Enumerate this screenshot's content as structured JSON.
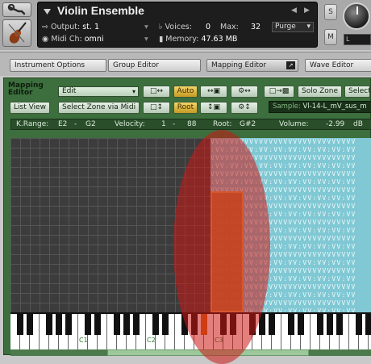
{
  "header": {
    "instrument_name": "Violin Ensemble",
    "output_label": "Output:",
    "output_value": "st. 1",
    "voices_label": "Voices:",
    "voices_value": "0",
    "max_label": "Max:",
    "max_value": "32",
    "purge_label": "Purge",
    "midi_label": "Midi Ch:",
    "midi_value": "omni",
    "memory_label": "Memory:",
    "memory_value": "47.63 MB",
    "solo_button": "S",
    "mute_button": "M",
    "tune_value": "L"
  },
  "editor_tabs": [
    {
      "label": "Instrument Options"
    },
    {
      "label": "Group Editor"
    },
    {
      "label": "Mapping Editor"
    },
    {
      "label": "Wave Editor"
    }
  ],
  "mapping": {
    "title": "Mapping Editor",
    "edit_menu": "Edit",
    "list_view": "List View",
    "select_zone_via_midi": "Select Zone via Midi",
    "auto_label": "Auto",
    "root_label": "Root",
    "solo_zone": "Solo Zone",
    "select_label": "Selecte",
    "sample_label": "Sample:",
    "sample_value": "Vl-14-L_mV_sus_m",
    "status": {
      "krange_label": "K.Range:",
      "krange_low": "E2",
      "krange_dash": "-",
      "krange_high": "G2",
      "velocity_label": "Velocity:",
      "vel_low": "1",
      "vel_dash": "-",
      "vel_high": "88",
      "root_label": "Root:",
      "root_value": "G#2",
      "volume_label": "Volume:",
      "volume_value": "-2.99",
      "volume_unit": "dB"
    },
    "octave_labels": [
      "C1",
      "C2",
      "C3"
    ],
    "zone_text_char": "V"
  }
}
